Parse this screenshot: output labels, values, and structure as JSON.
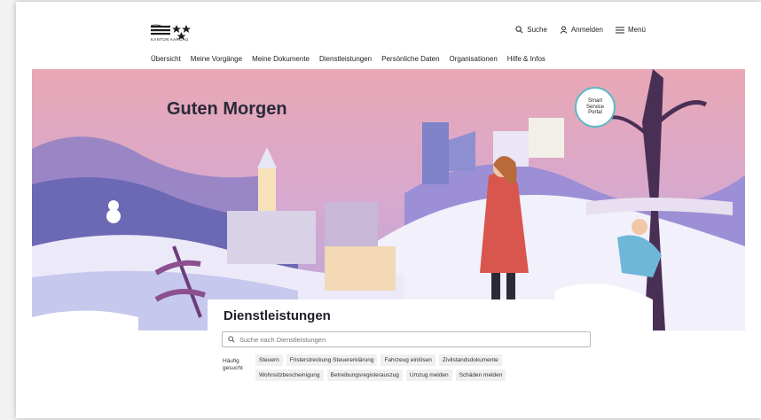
{
  "brand": {
    "name": "KANTON AARGAU"
  },
  "topbar": {
    "search_label": "Suche",
    "login_label": "Anmelden",
    "menu_label": "Menü"
  },
  "nav": {
    "items": [
      "Übersicht",
      "Meine Vorgänge",
      "Meine Dokumente",
      "Dienstleistungen",
      "Persönliche Daten",
      "Organisationen",
      "Hilfe & Infos"
    ]
  },
  "hero": {
    "greeting": "Guten Morgen",
    "badge": {
      "line1": "Smart",
      "line2": "Service",
      "line3": "Portal"
    }
  },
  "services": {
    "title": "Dienstleistungen",
    "search_placeholder": "Suche nach Dienstleistungen",
    "frequent_label_line1": "Häufig",
    "frequent_label_line2": "gesucht",
    "tags": [
      "Steuern",
      "Fristerstreckung Steuererklärung",
      "Fahrzeug einlösen",
      "Zivilstandsdokumente",
      "Wohnsitzbescheinigung",
      "Betreibungsregisterauszug",
      "Umzug melden",
      "Schäden melden"
    ]
  },
  "icons": {
    "search": "search-icon",
    "user": "user-icon",
    "menu": "hamburger-icon"
  },
  "colors": {
    "sky_top": "#e8a9b8",
    "sky_mid": "#c9a6d8",
    "snow": "#f4f2fb",
    "accent": "#5fb8c8"
  }
}
